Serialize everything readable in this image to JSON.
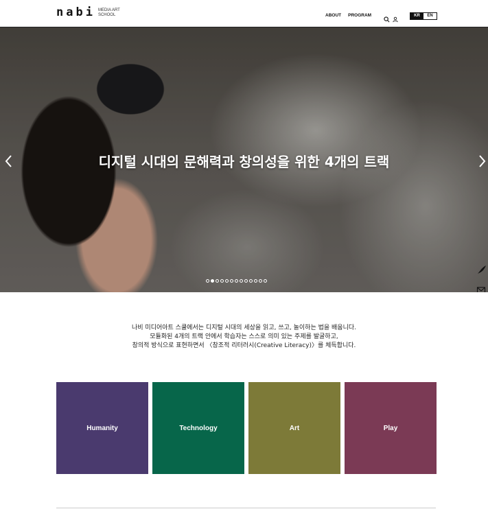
{
  "header": {
    "logo_word": "nabi",
    "logo_sub_line1": "MEDIA ART",
    "logo_sub_line2": "SCHOOL",
    "nav": [
      "ABOUT",
      "PROGRAM"
    ],
    "icons": [
      "search-icon",
      "user-icon"
    ],
    "lang": {
      "active": "KR",
      "inactive": "EN"
    }
  },
  "hero": {
    "title": "디지털 시대의 문해력과 창의성을 위한 4개의 트랙",
    "slide_count": 13,
    "active_slide": 2,
    "side_tools": [
      "pen-icon",
      "mail-icon",
      "chevron-up-icon"
    ]
  },
  "intro": {
    "line1": "나비 미디어아트 스쿨에서는 디지털 시대의 세상을 읽고, 쓰고, 놀이하는 법을 배웁니다.",
    "line2": "모듈화된 4개의 트랙 안에서 학습자는 스스로 의미 있는 주제를 발굴하고,",
    "line3": "창의적 방식으로 표현하면서 〈창조적 리터러시(Creative Literacy)〉를 체득합니다."
  },
  "tracks": [
    {
      "label": "Humanity",
      "color": "#4a3a6e"
    },
    {
      "label": "Technology",
      "color": "#07664a"
    },
    {
      "label": "Art",
      "color": "#7d7a38"
    },
    {
      "label": "Play",
      "color": "#7b3a55"
    }
  ]
}
